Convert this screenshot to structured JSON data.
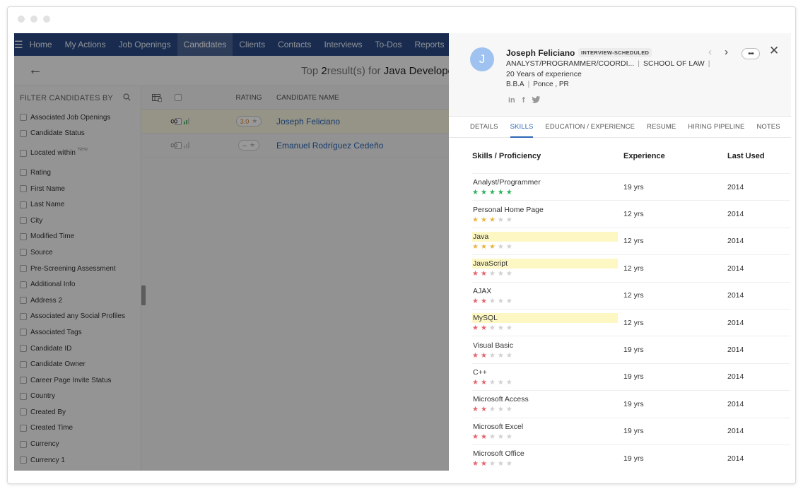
{
  "nav": {
    "items": [
      "Home",
      "My Actions",
      "Job Openings",
      "Candidates",
      "Clients",
      "Contacts",
      "Interviews",
      "To-Dos",
      "Reports"
    ],
    "active_index": 3
  },
  "results": {
    "prefix": "Top",
    "count": "2",
    "middle": "result(s)",
    "for": "for",
    "query": "Java Developer"
  },
  "filters": {
    "heading": "FILTER CANDIDATES BY",
    "items": [
      "Associated Job Openings",
      "Candidate Status",
      "Located within",
      "Rating",
      "First Name",
      "Last Name",
      "City",
      "Modified Time",
      "Source",
      "Pre-Screening Assessment",
      "Additional Info",
      "Address 2",
      "Associated any Social Profiles",
      "Associated Tags",
      "Candidate ID",
      "Candidate Owner",
      "Career Page Invite Status",
      "Country",
      "Created By",
      "Created Time",
      "Currency",
      "Currency 1"
    ],
    "new_badge": "New"
  },
  "table": {
    "headers": {
      "rating": "RATING",
      "name": "CANDIDATE NAME"
    },
    "rows": [
      {
        "rating": "3.0",
        "name": "Joseph Feliciano"
      },
      {
        "rating": "--",
        "name": "Emanuel Rodríguez Cedeño"
      }
    ]
  },
  "candidate": {
    "initial": "J",
    "name": "Joseph Feliciano",
    "status": "INTERVIEW-SCHEDULED",
    "title": "ANALYST/PROGRAMMER/COORDI...",
    "school": "SCHOOL OF LAW",
    "experience": "20 Years of experience",
    "degree": "B.B.A",
    "location": "Ponce , PR",
    "social_icons": [
      "linkedin-icon",
      "facebook-icon",
      "twitter-icon"
    ]
  },
  "tabs": [
    "DETAILS",
    "SKILLS",
    "EDUCATION / EXPERIENCE",
    "RESUME",
    "HIRING PIPELINE",
    "NOTES"
  ],
  "active_tab": 1,
  "skills": {
    "headers": {
      "skill": "Skills / Proficiency",
      "experience": "Experience",
      "last_used": "Last Used"
    },
    "colors": {
      "green": "#2cae5a",
      "gold": "#eab442",
      "red": "#e8616b",
      "off": "#d0d0d0",
      "highlight": "#fdf7c3"
    },
    "rows": [
      {
        "name": "Analyst/Programmer",
        "stars": 5,
        "color": "green",
        "highlight": false,
        "experience": "19 yrs",
        "last_used": "2014"
      },
      {
        "name": "Personal Home Page",
        "stars": 3,
        "color": "gold",
        "highlight": false,
        "experience": "12 yrs",
        "last_used": "2014"
      },
      {
        "name": "Java",
        "stars": 3,
        "color": "gold",
        "highlight": true,
        "experience": "12 yrs",
        "last_used": "2014"
      },
      {
        "name": "JavaScript",
        "stars": 2,
        "color": "red",
        "highlight": true,
        "experience": "12 yrs",
        "last_used": "2014"
      },
      {
        "name": "AJAX",
        "stars": 2,
        "color": "red",
        "highlight": false,
        "experience": "12 yrs",
        "last_used": "2014"
      },
      {
        "name": "MySQL",
        "stars": 2,
        "color": "red",
        "highlight": true,
        "experience": "12 yrs",
        "last_used": "2014"
      },
      {
        "name": "Visual Basic",
        "stars": 2,
        "color": "red",
        "highlight": false,
        "experience": "19 yrs",
        "last_used": "2014"
      },
      {
        "name": "C++",
        "stars": 2,
        "color": "red",
        "highlight": false,
        "experience": "19 yrs",
        "last_used": "2014"
      },
      {
        "name": "Microsoft Access",
        "stars": 2,
        "color": "red",
        "highlight": false,
        "experience": "19 yrs",
        "last_used": "2014"
      },
      {
        "name": "Microsoft Excel",
        "stars": 2,
        "color": "red",
        "highlight": false,
        "experience": "19 yrs",
        "last_used": "2014"
      },
      {
        "name": "Microsoft Office",
        "stars": 2,
        "color": "red",
        "highlight": false,
        "experience": "19 yrs",
        "last_used": "2014"
      }
    ]
  }
}
